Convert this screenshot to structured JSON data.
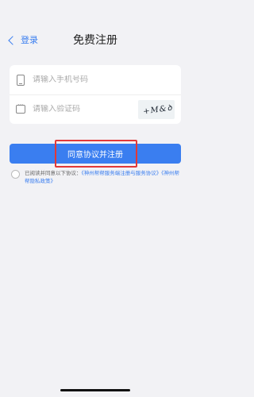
{
  "nav": {
    "back_label": "登录",
    "title": "免费注册"
  },
  "form": {
    "phone_placeholder": "请输入手机号码",
    "code_placeholder": "请输入验证码",
    "captcha_text": "+M&ꝺ"
  },
  "primary_button": {
    "label": "同意协议并注册"
  },
  "agreement": {
    "prefix": "已阅读并同意以下协议：",
    "link1": "《神州帮帮服务端注册与服务协议》",
    "link2": "《神州帮帮隐私政策》"
  },
  "icons": {
    "phone": "phone-icon",
    "code": "message-icon",
    "back": "chevron-left-icon"
  },
  "colors": {
    "accent": "#3a7ef0",
    "highlight": "#e23838",
    "background": "#f2f2f5"
  }
}
